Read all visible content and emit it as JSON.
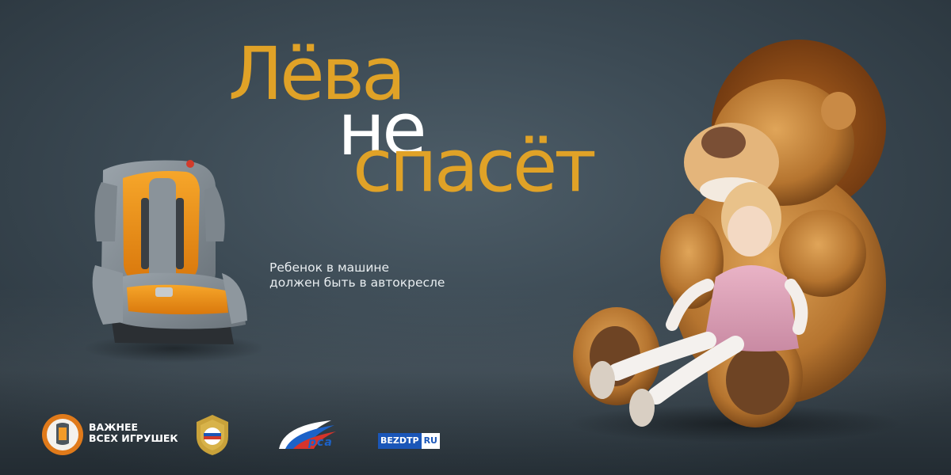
{
  "headline": {
    "line1": "Лёва",
    "line2": "не",
    "line3": "спасёт"
  },
  "tagline": {
    "line1": "Ребенок в машине",
    "line2": "должен быть в автокресле"
  },
  "logos": {
    "campaign_line1": "ВАЖНЕЕ",
    "campaign_line2": "ВСЕХ ИГРУШЕК",
    "rsa": "рса",
    "bezdtp_main": "BEZDTP",
    "bezdtp_ru": "RU"
  },
  "colors": {
    "accent": "#e0a227",
    "background": "#3c4a54",
    "text_light": "#ffffff",
    "brand_blue": "#1a56b8"
  }
}
